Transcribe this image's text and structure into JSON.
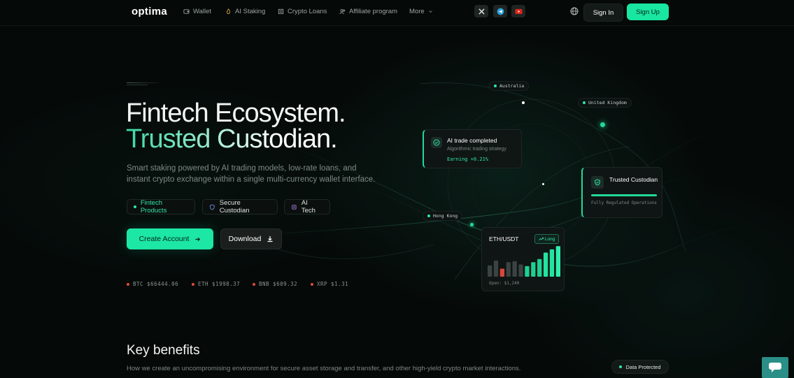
{
  "nav": {
    "logo": "optima",
    "items": [
      {
        "label": "Wallet",
        "icon": "wallet-icon"
      },
      {
        "label": "AI Staking",
        "icon": "flame-icon"
      },
      {
        "label": "Crypto Loans",
        "icon": "loans-icon"
      },
      {
        "label": "Affiliate program",
        "icon": "users-icon"
      },
      {
        "label": "More",
        "icon": "chevron-down-icon"
      }
    ],
    "social": [
      "x-icon",
      "telegram-icon",
      "youtube-icon"
    ],
    "sign_in": "Sign In",
    "sign_up": "Sign Up"
  },
  "hero": {
    "title_line1": "Fintech Ecosystem.",
    "title_line2": "Trusted Custodian.",
    "subtitle": "Smart staking powered by AI trading models, low-rate loans, and instant crypto exchange within a single multi-currency wallet interface.",
    "tags": [
      "Fintech Products",
      "Secure Custodian",
      "AI Tech"
    ],
    "create_account": "Create Account",
    "download": "Download",
    "tickers": [
      "BTC $66444.06",
      "ETH $1998.37",
      "BNB $609.32",
      "XRP $1.31"
    ]
  },
  "map": {
    "locations": [
      "Australia",
      "United Kingdom",
      "Hong Kong"
    ]
  },
  "cards": {
    "ai_trade": {
      "title": "AI trade completed",
      "subtitle": "Algorithmic trading strategy",
      "earning": "Earning +0.21%"
    },
    "trusted": {
      "title": "Trusted Custodian",
      "subtitle": "Fully Regulated Operations"
    },
    "eth": {
      "pair": "ETH/USDT",
      "badge": "Long",
      "open": "Open: $1,240",
      "bars": [
        {
          "v": 0.35,
          "c": "#3a4341"
        },
        {
          "v": 0.5,
          "c": "#3a4341"
        },
        {
          "v": 0.25,
          "c": "#d9473a"
        },
        {
          "v": 0.45,
          "c": "#3a4341"
        },
        {
          "v": 0.48,
          "c": "#3a4341"
        },
        {
          "v": 0.38,
          "c": "#3a4341"
        },
        {
          "v": 0.33,
          "c": "#1fcf92"
        },
        {
          "v": 0.45,
          "c": "#1fcf92"
        },
        {
          "v": 0.55,
          "c": "#1fcf92"
        },
        {
          "v": 0.75,
          "c": "#24e3a1"
        },
        {
          "v": 0.85,
          "c": "#24e3a1"
        },
        {
          "v": 0.95,
          "c": "#2ef0ad"
        }
      ]
    }
  },
  "benefits": {
    "title": "Key benefits",
    "subtitle": "How we create an uncompromising environment for secure asset storage and transfer, and other high-yield crypto market interactions.",
    "badge": "Data Protected"
  },
  "colors": {
    "accent": "#1de7a4",
    "background": "#050908",
    "negative": "#e14b3a"
  }
}
